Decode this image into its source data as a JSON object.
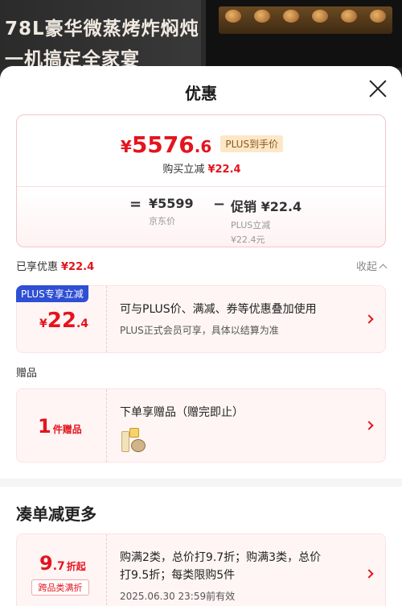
{
  "banner": {
    "title": "78L豪华微蒸烤炸焖炖",
    "subtitle": "一机搞定全家宴"
  },
  "sheet": {
    "title": "优惠",
    "close_icon": "close-icon"
  },
  "price_summary": {
    "currency": "¥",
    "final_int": "5576",
    "final_dec": ".6",
    "plus_tag": "PLUS到手价",
    "cut_label": "购买立减",
    "cut_value": "¥22.4",
    "equals": "=",
    "minus": "−",
    "jd_price": "¥5599",
    "jd_label": "京东价",
    "promo_value": "促销 ¥22.4",
    "promo_label_1": "PLUS立减",
    "promo_label_2": "¥22.4元"
  },
  "applied": {
    "label": "已享优惠",
    "value": "¥22.4",
    "collapse_label": "收起"
  },
  "plus_offer": {
    "badge": "PLUS专享立减",
    "currency": "¥",
    "int": "22",
    "dec": ".4",
    "line1": "可与PLUS价、满减、券等优惠叠加使用",
    "line2": "PLUS正式会员可享，具体以结算为准"
  },
  "gift_section": {
    "label": "赠品",
    "count": "1",
    "count_unit": "件赠品",
    "line1": "下单享赠品（赠完即止）",
    "gift_icon": "gift-icon"
  },
  "more_section": {
    "title": "凑单减更多"
  },
  "discount_offer": {
    "int": "9",
    "dec": ".7",
    "unit": "折起",
    "tag": "跨品类满折",
    "line1": "购满2类，总价打9.7折；购满3类，总价",
    "line2": "打9.5折；每类限购5件",
    "line3": "2025.06.30 23:59前有效"
  },
  "colors": {
    "accent_red": "#e4141e",
    "plus_blue": "#2f4fd4",
    "plus_gold_bg": "#fde7c6"
  }
}
